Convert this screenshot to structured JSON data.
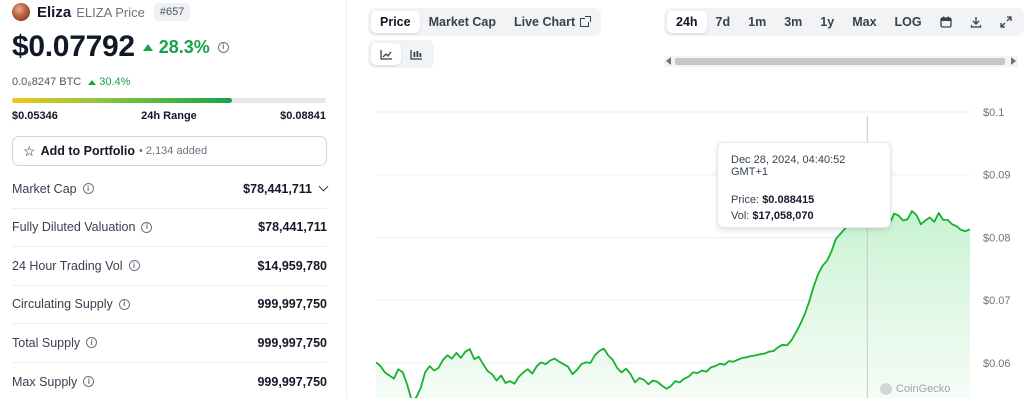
{
  "coin": {
    "name": "Eliza",
    "symbol_label": "ELIZA Price",
    "rank": "#657",
    "price": "$0.07792",
    "change_24h": "28.3%",
    "btc_price": "0.0₆8247 BTC",
    "btc_change": "30.4%"
  },
  "range": {
    "low": "$0.05346",
    "label": "24h Range",
    "high": "$0.08841",
    "position": 0.7
  },
  "portfolio": {
    "label": "Add to Portfolio",
    "count": "• 2,134 added"
  },
  "stats": [
    {
      "label": "Market Cap",
      "value": "$78,441,711"
    },
    {
      "label": "Fully Diluted Valuation",
      "value": "$78,441,711"
    },
    {
      "label": "24 Hour Trading Vol",
      "value": "$14,959,780"
    },
    {
      "label": "Circulating Supply",
      "value": "999,997,750"
    },
    {
      "label": "Total Supply",
      "value": "999,997,750"
    },
    {
      "label": "Max Supply",
      "value": "999,997,750"
    }
  ],
  "chart_tabs": [
    "Price",
    "Market Cap",
    "Live Chart"
  ],
  "time_tabs": [
    "24h",
    "7d",
    "1m",
    "3m",
    "1y",
    "Max",
    "LOG"
  ],
  "icons": {
    "calendar": "calendar-icon",
    "download": "download-icon",
    "expand": "expand-icon",
    "line_chart": "line-chart-icon",
    "candle_chart": "candlestick-chart-icon"
  },
  "tooltip": {
    "date": "Dec 28, 2024, 04:40:52 GMT+1",
    "price_label": "Price:",
    "price_value": "$0.088415",
    "vol_label": "Vol:",
    "vol_value": "$17,058,070"
  },
  "watermark": "CoinGecko",
  "colors": {
    "positive": "#16a34a",
    "line": "#16b12f",
    "area_top": "#bbf0c6"
  },
  "chart_data": {
    "type": "area",
    "title": "",
    "xlabel": "",
    "ylabel": "",
    "y_tick_labels": [
      "$0.1",
      "$0.09",
      "$0.08",
      "$0.07",
      "$0.06"
    ],
    "y_ticks": [
      0.1,
      0.09,
      0.08,
      0.07,
      0.06
    ],
    "ylim": [
      0.0525,
      0.1
    ],
    "grid": true,
    "legend": "none",
    "series": [
      {
        "values": [
          0.0601,
          0.0595,
          0.0585,
          0.058,
          0.0575,
          0.059,
          0.0585,
          0.0565,
          0.054,
          0.0545,
          0.056,
          0.0585,
          0.0595,
          0.0588,
          0.0592,
          0.0605,
          0.0612,
          0.0607,
          0.0616,
          0.0608,
          0.0618,
          0.0622,
          0.0606,
          0.061,
          0.0598,
          0.0587,
          0.0582,
          0.0572,
          0.058,
          0.0568,
          0.0571,
          0.0567,
          0.0578,
          0.0585,
          0.059,
          0.0583,
          0.0595,
          0.0601,
          0.0598,
          0.0604,
          0.0607,
          0.0602,
          0.0598,
          0.0594,
          0.0582,
          0.0589,
          0.0598,
          0.0601,
          0.06,
          0.0612,
          0.0619,
          0.0623,
          0.0612,
          0.0605,
          0.0592,
          0.0585,
          0.0591,
          0.0582,
          0.0569,
          0.0576,
          0.0573,
          0.0566,
          0.0572,
          0.057,
          0.0564,
          0.0559,
          0.0563,
          0.0571,
          0.0569,
          0.0575,
          0.0578,
          0.0585,
          0.0584,
          0.0588,
          0.0586,
          0.0593,
          0.0595,
          0.0599,
          0.0597,
          0.0603,
          0.0602,
          0.0605,
          0.0608,
          0.0609,
          0.0611,
          0.0612,
          0.0614,
          0.0615,
          0.0618,
          0.0619,
          0.0625,
          0.0629,
          0.0628,
          0.0636,
          0.0648,
          0.0662,
          0.0678,
          0.0698,
          0.0722,
          0.0742,
          0.0755,
          0.0763,
          0.0778,
          0.0798,
          0.0806,
          0.0814,
          0.0824,
          0.0839,
          0.0854,
          0.0868,
          0.0884,
          0.0862,
          0.0845,
          0.0822,
          0.0828,
          0.0822,
          0.0838,
          0.0835,
          0.0827,
          0.0829,
          0.0842,
          0.0836,
          0.0821,
          0.0827,
          0.0832,
          0.0825,
          0.0839,
          0.0828,
          0.0828,
          0.0821,
          0.0818,
          0.0812,
          0.081,
          0.0813
        ]
      }
    ],
    "highlight_index": 110
  }
}
